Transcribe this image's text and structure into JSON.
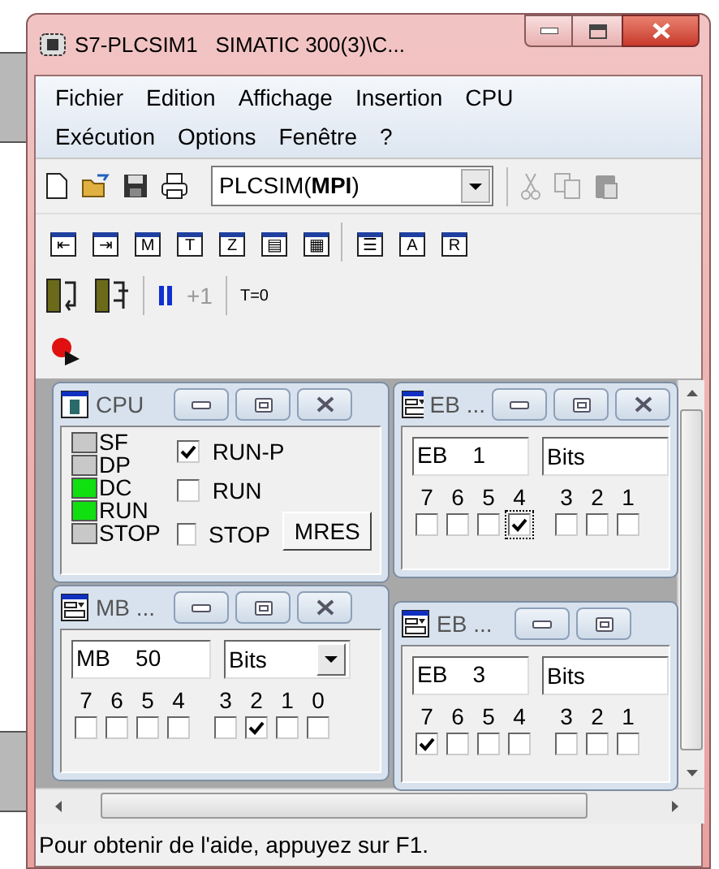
{
  "window": {
    "title": "S7-PLCSIM1   SIMATIC 300(3)\\C..."
  },
  "menu": [
    {
      "label": "Fichier"
    },
    {
      "label": "Edition"
    },
    {
      "label": "Affichage"
    },
    {
      "label": "Insertion"
    },
    {
      "label": "CPU"
    },
    {
      "label": "Exécution"
    },
    {
      "label": "Options"
    },
    {
      "label": "Fenêtre"
    },
    {
      "label": "?"
    }
  ],
  "toolbar": {
    "connection": "PLCSIM(**MPI**)"
  },
  "insert_toolbar": [
    {
      "glyph": "⇤"
    },
    {
      "glyph": "⇥"
    },
    {
      "glyph": "M"
    },
    {
      "glyph": "T"
    },
    {
      "glyph": "Z"
    },
    {
      "glyph": "▤"
    },
    {
      "glyph": "▦"
    },
    {
      "glyph": "☰"
    },
    {
      "glyph": "A"
    },
    {
      "glyph": "R"
    }
  ],
  "run_toolbar": [
    {
      "kind": "icon"
    },
    {
      "kind": "icon"
    },
    {
      "kind": "pause"
    },
    {
      "kind": "text",
      "label": "+1",
      "disabled": true
    },
    {
      "kind": "text",
      "label": "T=0",
      "disabled": false
    }
  ],
  "subwindows": [
    {
      "kind": "cpu",
      "title": "CPU",
      "buttons": [
        {
          "kind": "minimize"
        },
        {
          "kind": "restore"
        },
        {
          "kind": "close"
        }
      ],
      "leds": [
        {
          "label": "SF",
          "on": false
        },
        {
          "label": "DP",
          "on": false
        },
        {
          "label": "DC",
          "on": true
        },
        {
          "label": "RUN",
          "on": true
        },
        {
          "label": "STOP",
          "on": false
        }
      ],
      "modes": [
        {
          "label": "RUN-P",
          "checked": true
        },
        {
          "label": "RUN",
          "checked": false
        },
        {
          "label": "STOP",
          "checked": false
        }
      ],
      "button": "MRES"
    },
    {
      "kind": "bits",
      "title": "EB ...",
      "buttons": [
        {
          "kind": "minimize"
        },
        {
          "kind": "restore"
        },
        {
          "kind": "close"
        }
      ],
      "address": "EB    1",
      "format": "Bits",
      "arrow": false,
      "bits": [
        {
          "label": "7",
          "checked": false,
          "focused": false
        },
        {
          "label": "6",
          "checked": false,
          "focused": false
        },
        {
          "label": "5",
          "checked": false,
          "focused": false
        },
        {
          "label": "4",
          "checked": true,
          "focused": true
        },
        {
          "label": "3",
          "checked": false,
          "focused": false
        },
        {
          "label": "2",
          "checked": false,
          "focused": false
        },
        {
          "label": "1",
          "checked": false,
          "focused": false
        }
      ]
    },
    {
      "kind": "bits",
      "title": "MB ...",
      "buttons": [
        {
          "kind": "minimize"
        },
        {
          "kind": "restore"
        },
        {
          "kind": "close"
        }
      ],
      "address": "MB    50",
      "format": "Bits",
      "arrow": true,
      "bits": [
        {
          "label": "7",
          "checked": false,
          "focused": false
        },
        {
          "label": "6",
          "checked": false,
          "focused": false
        },
        {
          "label": "5",
          "checked": false,
          "focused": false
        },
        {
          "label": "4",
          "checked": false,
          "focused": false
        },
        {
          "label": "3",
          "checked": false,
          "focused": false
        },
        {
          "label": "2",
          "checked": true,
          "focused": false
        },
        {
          "label": "1",
          "checked": false,
          "focused": false
        },
        {
          "label": "0",
          "checked": false,
          "focused": false
        }
      ]
    },
    {
      "kind": "bits",
      "title": "EB ...",
      "buttons": [
        {
          "kind": "minimize"
        },
        {
          "kind": "restore"
        }
      ],
      "address": "EB    3",
      "format": "Bits",
      "arrow": false,
      "bits": [
        {
          "label": "7",
          "checked": true,
          "focused": false
        },
        {
          "label": "6",
          "checked": false,
          "focused": false
        },
        {
          "label": "5",
          "checked": false,
          "focused": false
        },
        {
          "label": "4",
          "checked": false,
          "focused": false
        },
        {
          "label": "3",
          "checked": false,
          "focused": false
        },
        {
          "label": "2",
          "checked": false,
          "focused": false
        },
        {
          "label": "1",
          "checked": false,
          "focused": false
        }
      ]
    }
  ],
  "status_bar": "Pour obtenir de l'aide, appuyez sur F1."
}
